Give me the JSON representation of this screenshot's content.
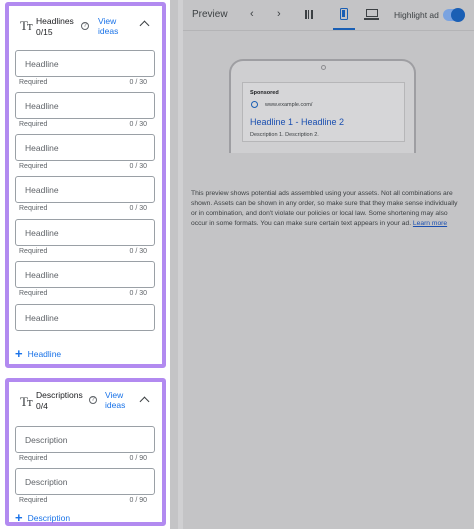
{
  "headlines": {
    "title": "Headlines",
    "count": "0/15",
    "view_ideas": "View ideas",
    "placeholder": "Headline",
    "required_label": "Required",
    "char_count": "0 / 30",
    "add_label": "Headline"
  },
  "descriptions": {
    "title": "Descriptions",
    "count": "0/4",
    "view_ideas": "View ideas",
    "placeholder": "Description",
    "required_label": "Required",
    "char_count": "0 / 90",
    "add_label": "Description"
  },
  "preview": {
    "title": "Preview",
    "highlight_label": "Highlight ad",
    "highlight_on": true
  },
  "ad": {
    "sponsored": "Sponsored",
    "url": "www.example.com/",
    "headline": "Headline 1 - Headline 2",
    "description": "Description 1. Description 2."
  },
  "info": {
    "text": "This preview shows potential ads assembled using your assets. Not all combinations are shown. Assets can be shown in any order, so make sure that they make sense individually or in combination, and don't violate our policies or local law. Some shortening may also occur in some formats. You can make sure certain text appears in your ad.",
    "link": "Learn more"
  },
  "colors": {
    "accent": "#1a73e8",
    "panel_highlight": "#b28af0",
    "overlay": "#c4c4c6"
  }
}
